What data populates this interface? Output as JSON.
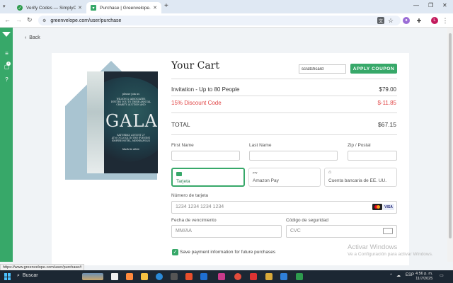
{
  "browser": {
    "tabs": [
      {
        "title": "Verify Codes — SimplyCodes",
        "active": false,
        "favicon": "simplycodes-favicon"
      },
      {
        "title": "Purchase | Greenvelope.com",
        "active": true,
        "favicon": "greenvelope-favicon"
      }
    ],
    "url": "greenvelope.com/user/purchase",
    "profile_initial": "L"
  },
  "nav": {
    "back_label": "Back"
  },
  "invitation": {
    "line1": "please join us",
    "line2": "WILSON & ASSOCIATES\nINVITES YOU TO THEIR ANNUAL\nCHARITY AUCTION AND",
    "title": "GALA",
    "line3": "SATURDAY, AUGUST 27\nAT 6 O'CLOCK IN THE EVENING\nEMPIRE HOTEL, MINNEAPOLIS",
    "line4": "black tie attire"
  },
  "cart": {
    "title": "Your Cart",
    "promo_input_value": "scratchcard",
    "apply_label": "APPLY COUPON",
    "item_label": "Invitation - Up to 80 People",
    "item_price": "$79.00",
    "discount_label": "15% Discount Code",
    "discount_value": "$-11.85",
    "total_label": "TOTAL",
    "total_value": "$67.15"
  },
  "form": {
    "first_name_label": "First Name",
    "last_name_label": "Last Name",
    "zip_label": "Zip / Postal",
    "payment_options": [
      {
        "label": "Tarjeta",
        "selected": true
      },
      {
        "label": "Amazon Pay",
        "selected": false,
        "icon_text": "pay"
      },
      {
        "label": "Cuenta bancaria de EE. UU.",
        "selected": false
      }
    ],
    "card_number_label": "Número de tarjeta",
    "card_number_placeholder": "1234 1234 1234 1234",
    "visa_label": "VISA",
    "expiry_label": "Fecha de vencimiento",
    "expiry_placeholder": "MM/AA",
    "cvc_label": "Código de seguridad",
    "cvc_placeholder": "CVC",
    "save_label": "Save payment information for future purchases",
    "save_checked": true
  },
  "watermark": {
    "title": "Activar Windows",
    "subtitle": "Ve a Configuración para activar Windows."
  },
  "status_url": "https://www.greenvelope.com/user/purchase#",
  "taskbar": {
    "search_label": "Buscar",
    "language": "ESP",
    "time": "4:56 p. m.",
    "date": "11/7/2025"
  },
  "colors": {
    "brand_green": "#37a869",
    "discount_red": "#e14646"
  }
}
